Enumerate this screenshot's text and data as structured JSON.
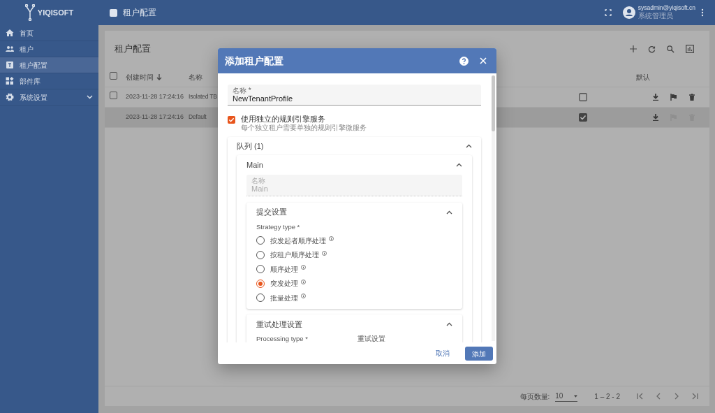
{
  "app": {
    "brand": "YIQISOFT",
    "page_title": "租户配置",
    "user": {
      "email": "sysadmin@yiqisoft.cn",
      "role": "系统管理员"
    }
  },
  "sidebar": {
    "items": [
      {
        "label": "首页",
        "kind": "link",
        "selected": false
      },
      {
        "label": "租户",
        "kind": "link",
        "selected": false
      },
      {
        "label": "租户配置",
        "kind": "link",
        "selected": true
      },
      {
        "label": "部件库",
        "kind": "link",
        "selected": false
      },
      {
        "label": "系统设置",
        "kind": "group",
        "selected": false
      }
    ]
  },
  "table": {
    "title": "租户配置",
    "all_checked": false,
    "columns": [
      {
        "label": "创建时间",
        "sorted": true
      },
      {
        "label": "名称",
        "sorted": false
      },
      {
        "label": "默认",
        "sorted": false
      }
    ],
    "rows": [
      {
        "created": "2023-11-28 17:24:16",
        "name": "Isolated TB",
        "is_default": false,
        "selected": false
      },
      {
        "created": "2023-11-28 17:24:16",
        "name": "Default",
        "is_default": true,
        "selected": true
      }
    ],
    "paginator": {
      "page_size_label": "每页数量:",
      "page_size": "10",
      "range": "1 – 2 - 2"
    }
  },
  "dialog": {
    "title": "添加租户配置",
    "name_field": {
      "label": "名称 *",
      "value": "NewTenantProfile"
    },
    "isolated": {
      "label": "使用独立的规则引擎服务",
      "hint": "每个独立租户需要单独的规则引擎微服务",
      "checked": true
    },
    "queues": {
      "title": "队列 (1)",
      "expanded": true,
      "items": [
        {
          "title": "Main",
          "expanded": true,
          "name_field": {
            "label": "名称",
            "value": "Main",
            "disabled": true
          },
          "submit": {
            "title": "提交设置",
            "expanded": true,
            "label": "Strategy type *",
            "options": [
              {
                "label": "按发起者顺序处理",
                "selected": false
              },
              {
                "label": "按租户顺序处理",
                "selected": false
              },
              {
                "label": "顺序处理",
                "selected": false
              },
              {
                "label": "突发处理",
                "selected": true
              },
              {
                "label": "批量处理",
                "selected": false
              }
            ]
          },
          "retry": {
            "title": "重试处理设置",
            "expanded": true,
            "label": "Processing type *",
            "label_2": "重试设置"
          }
        }
      ]
    },
    "buttons": {
      "cancel": "取消",
      "add": "添加"
    }
  }
}
